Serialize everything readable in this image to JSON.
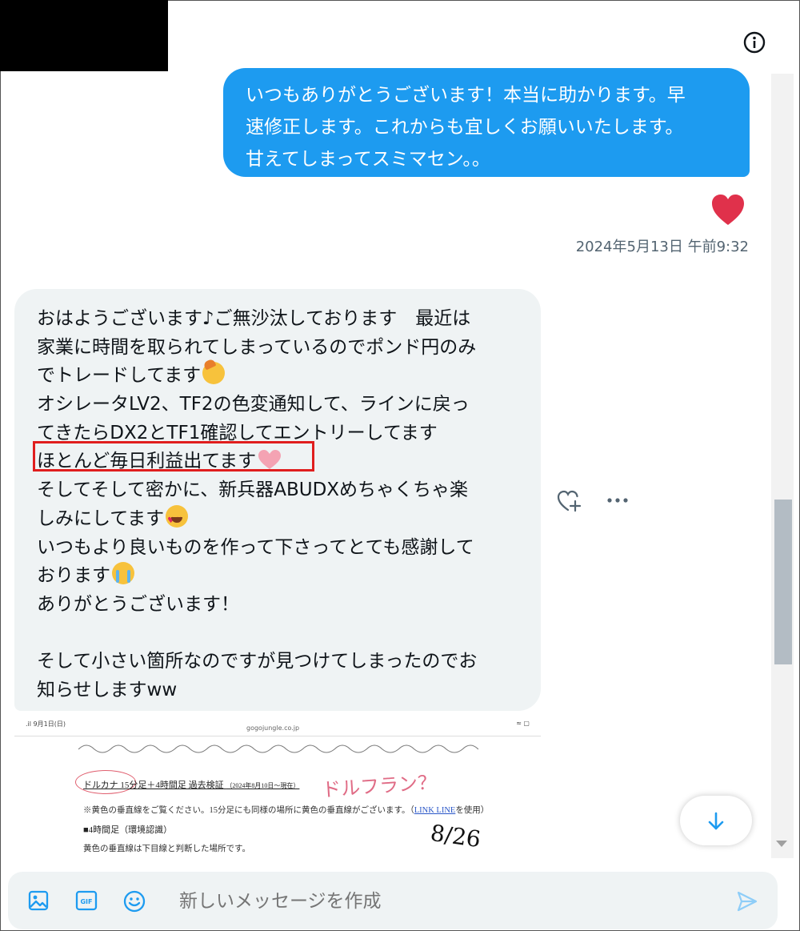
{
  "conversation": {
    "sent_message": {
      "lines": [
        "いつもありがとうございます！本当に助かります。早",
        "速修正します。これからも宜しくお願いいたします。",
        "甘えてしまってスミマセン。。"
      ],
      "reaction": "heart",
      "timestamp": "2024年5月13日 午前9:32"
    },
    "received_message": {
      "lines": [
        "おはようございます♪ご無沙汰しております　最近は",
        "家業に時間を取られてしまっているのでポンド円のみ",
        "でトレードしてます",
        "オシレータLV2、TF2の色変通知して、ラインに戻っ",
        "てきたらDX2とTF1確認してエントリーしてます",
        "ほとんど毎日利益出てます",
        "そしてそして密かに、新兵器ABUDXめちゃくちゃ楽",
        "しみにしてます",
        "いつもより良いものを作って下さってとても感謝して",
        "おります",
        "ありがとうございます！",
        "",
        "そして小さい箇所なのですが見つけてしまったのでお",
        "知らせしますww"
      ],
      "emojis": {
        "line_2": "saluting-face",
        "line_5": "pink-heart",
        "line_7": "heart-eyes-face",
        "line_9": "crying-face"
      }
    },
    "attachment": {
      "status_left": ".il  9月1日(日)",
      "status_url": "gogojungle.co.jp",
      "status_right": "≈ ▢",
      "doc_title": "ドルカナ 15分足＋4時間足 過去検証",
      "doc_title_small": "（2024年8月10日～現在）",
      "handwritten_note": "ドルフラン？",
      "note_text_a": "※黄色の垂直線をご覧ください。15分足にも同様の場所に黄色の垂直線がございます。（",
      "note_link": "LINK LINE",
      "note_text_b": "を使用）",
      "section_title": "■4時間足（環境認識）",
      "body_text": "黄色の垂直線は下目線と判断した場所です。",
      "handwritten_date": "8/26"
    }
  },
  "composer": {
    "placeholder": "新しいメッセージを作成"
  },
  "colors": {
    "sent_bubble": "#1d9bf0",
    "received_bubble": "#eff3f4",
    "heart": "#e0314b",
    "highlight_box": "#e01e1e",
    "accent": "#1d9bf0"
  },
  "icons": {
    "header": "info-icon",
    "message_actions": [
      "add-reaction-icon",
      "more-icon"
    ],
    "composer": [
      "image-icon",
      "gif-icon",
      "emoji-icon",
      "send-icon"
    ],
    "scroll": "arrow-down-icon"
  }
}
